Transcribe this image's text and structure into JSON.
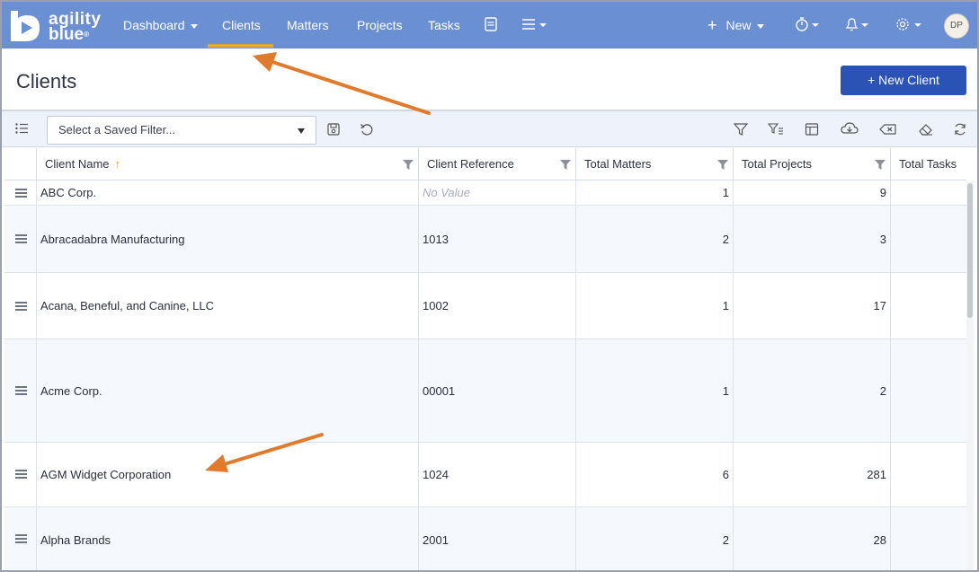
{
  "brand": {
    "line1": "agility",
    "line2": "blue",
    "mark": "®"
  },
  "nav": {
    "dashboard": "Dashboard",
    "clients": "Clients",
    "matters": "Matters",
    "projects": "Projects",
    "tasks": "Tasks",
    "new": "New",
    "avatar_initials": "DP"
  },
  "page": {
    "title": "Clients",
    "new_client_button": "+ New Client"
  },
  "toolbar": {
    "saved_filter_placeholder": "Select a Saved Filter..."
  },
  "table": {
    "columns": [
      "Client Name",
      "Client Reference",
      "Total Matters",
      "Total Projects",
      "Total Tasks"
    ],
    "sort_indicator": "↑",
    "rows": [
      {
        "name": "ABC Corp.",
        "reference": "No Value",
        "matters": "1",
        "projects": "9"
      },
      {
        "name": "Abracadabra Manufacturing",
        "reference": "1013",
        "matters": "2",
        "projects": "3"
      },
      {
        "name": "Acana, Beneful, and Canine, LLC",
        "reference": "1002",
        "matters": "1",
        "projects": "17"
      },
      {
        "name": "Acme Corp.",
        "reference": "00001",
        "matters": "1",
        "projects": "2"
      },
      {
        "name": "AGM Widget Corporation",
        "reference": "1024",
        "matters": "6",
        "projects": "281"
      },
      {
        "name": "Alpha Brands",
        "reference": "2001",
        "matters": "2",
        "projects": "28"
      }
    ]
  },
  "colors": {
    "nav_bg": "#6a8fd2",
    "active_tab": "#e3a736",
    "primary_button": "#2a53b5",
    "annotation_arrow": "#e07b2e"
  },
  "icons": {
    "tasks_list": "list-icon",
    "save": "save-icon",
    "reset": "undo-icon",
    "filter": "filter-icon",
    "filter_list": "filter-list-icon",
    "columns": "columns-icon",
    "download": "cloud-download-icon",
    "clear_filter": "clear-icon",
    "eraser": "eraser-icon",
    "refresh": "refresh-icon"
  }
}
